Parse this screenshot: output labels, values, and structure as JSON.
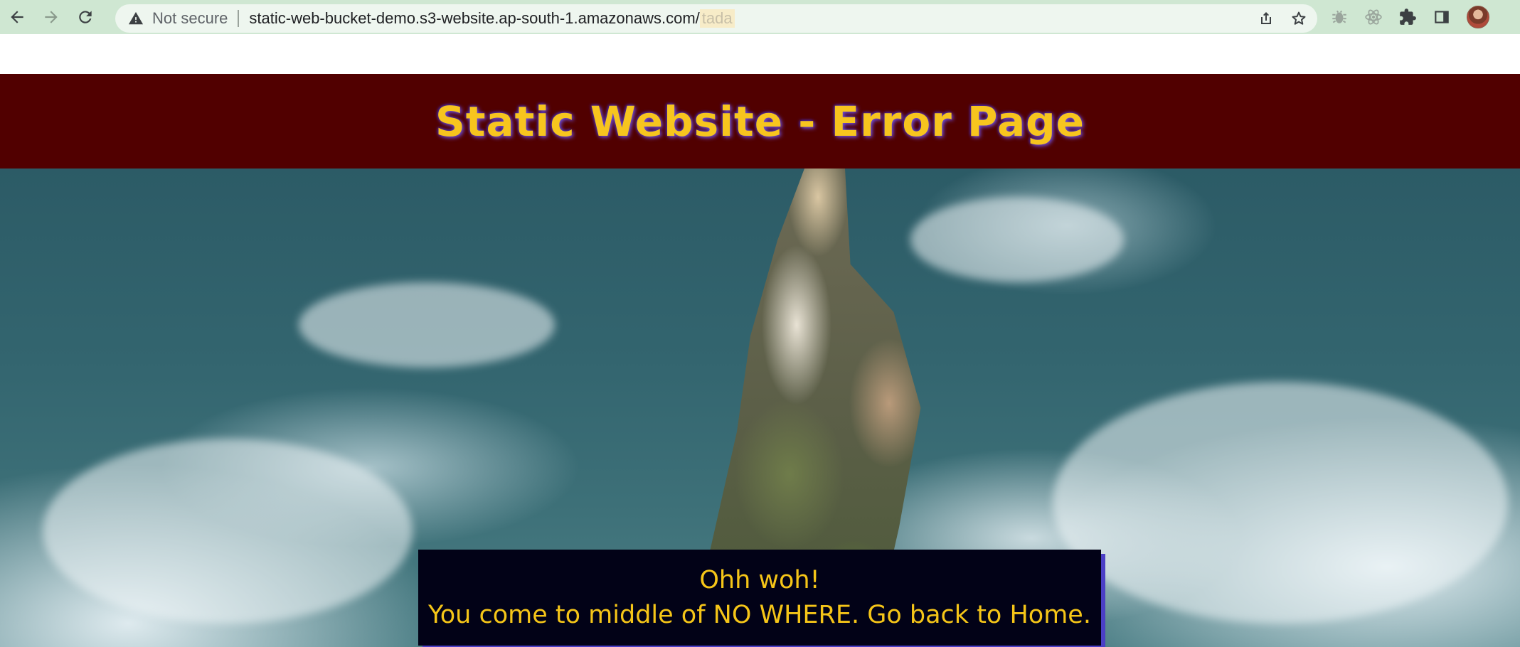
{
  "browser": {
    "security_label": "Not secure",
    "url_host": "static-web-bucket-demo.s3-website.ap-south-1.amazonaws.com/",
    "url_path": "tada",
    "icons": {
      "back": "back-arrow-icon",
      "forward": "forward-arrow-icon",
      "reload": "reload-icon",
      "warning": "warning-icon",
      "share": "share-icon",
      "bookmark": "star-icon",
      "extension_bug": "bug-extension-icon",
      "extension_react": "react-extension-icon",
      "extensions": "puzzle-icon",
      "side_panel": "side-panel-icon",
      "profile": "profile-avatar"
    }
  },
  "page": {
    "title": "Static Website - Error Page",
    "message_line_1": "Ohh woh!",
    "message_line_2": "You come to middle of NO WHERE. Go back to Home."
  },
  "colors": {
    "header_background": "#510000",
    "title_color": "#f7c51e",
    "message_background": "#020217",
    "message_text": "#f5c518",
    "message_shadow": "#4b3fc6",
    "chrome_background": "#cfe7d2"
  }
}
